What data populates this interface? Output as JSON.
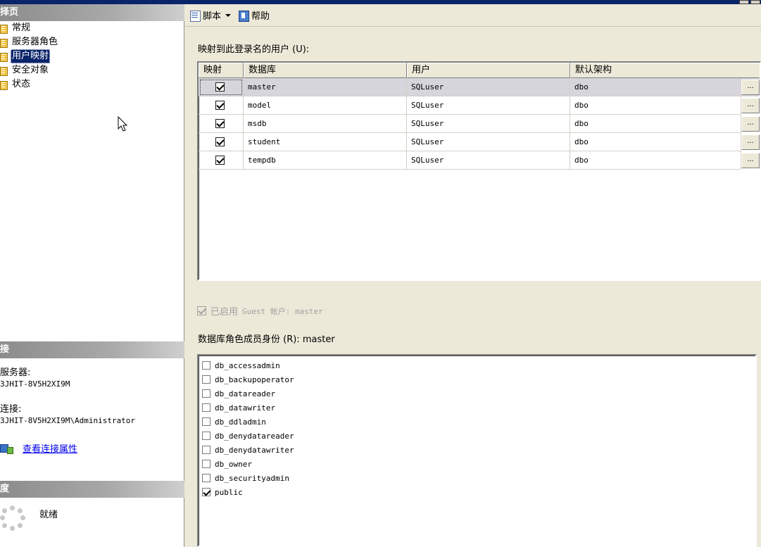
{
  "left": {
    "nav_title": "择页",
    "nav_items": [
      {
        "label": "常规"
      },
      {
        "label": "服务器角色"
      },
      {
        "label": "用户映射",
        "selected": true
      },
      {
        "label": "安全对象"
      },
      {
        "label": "状态"
      }
    ],
    "connection_title": "接",
    "server_label": "服务器:",
    "server_value": "3JHIT-8V5H2XI9M",
    "connection_label": "连接:",
    "connection_value": "3JHIT-8V5H2XI9M\\Administrator",
    "view_props_link": "查看连接属性",
    "progress_title": "度",
    "progress_status": "就绪"
  },
  "toolbar": {
    "script_label": "脚本",
    "help_label": "帮助"
  },
  "users_grid": {
    "caption": "映射到此登录名的用户 (U):",
    "columns": [
      "映射",
      "数据库",
      "用户",
      "默认架构"
    ],
    "rows": [
      {
        "mapped": true,
        "database": "master",
        "user": "SQLuser",
        "schema": "dbo",
        "selected": true
      },
      {
        "mapped": true,
        "database": "model",
        "user": "SQLuser",
        "schema": "dbo"
      },
      {
        "mapped": true,
        "database": "msdb",
        "user": "SQLuser",
        "schema": "dbo"
      },
      {
        "mapped": true,
        "database": "student",
        "user": "SQLuser",
        "schema": "dbo"
      },
      {
        "mapped": true,
        "database": "tempdb",
        "user": "SQLuser",
        "schema": "dbo"
      }
    ],
    "ellipsis": "..."
  },
  "guest": {
    "prefix": "已启用",
    "text": "Guest 帐户: master",
    "checked": true
  },
  "roles": {
    "caption": "数据库角色成员身份 (R): master",
    "items": [
      {
        "label": "db_accessadmin",
        "checked": false
      },
      {
        "label": "db_backupoperator",
        "checked": false
      },
      {
        "label": "db_datareader",
        "checked": false
      },
      {
        "label": "db_datawriter",
        "checked": false
      },
      {
        "label": "db_ddladmin",
        "checked": false
      },
      {
        "label": "db_denydatareader",
        "checked": false
      },
      {
        "label": "db_denydatawriter",
        "checked": false
      },
      {
        "label": "db_owner",
        "checked": false
      },
      {
        "label": "db_securityadmin",
        "checked": false
      },
      {
        "label": "public",
        "checked": true
      }
    ]
  },
  "colors": {
    "selection": "#0a246a",
    "link": "#0000ee",
    "section_header": "#8c8c8c",
    "selected_row": "#d6d5db"
  }
}
